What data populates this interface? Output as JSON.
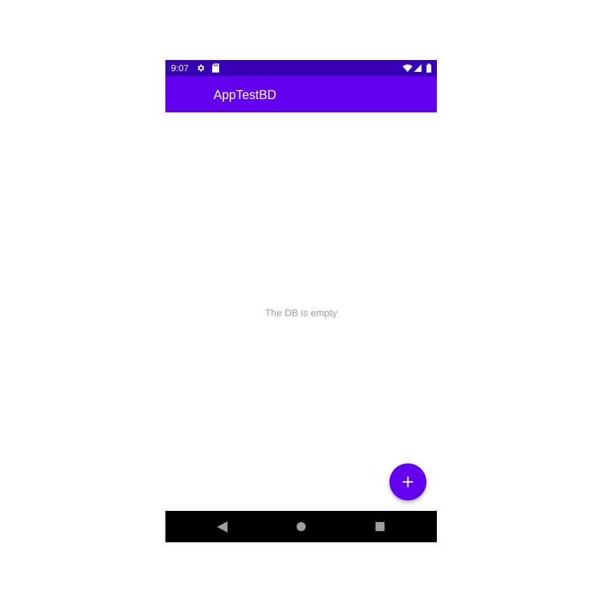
{
  "status_bar": {
    "time": "9:07",
    "left_icons": [
      "gear-icon",
      "sd-card-icon"
    ],
    "right_icons": [
      "wifi-icon",
      "cell-signal-icon",
      "battery-icon"
    ]
  },
  "app_bar": {
    "title": "AppTestBD"
  },
  "content": {
    "empty_message": "The DB is empty"
  },
  "fab": {
    "icon": "plus-icon"
  },
  "nav_bar": {
    "buttons": [
      "back-icon",
      "home-icon",
      "recents-icon"
    ]
  },
  "colors": {
    "status_bar": "#3700b3",
    "primary": "#6200ee",
    "empty_text": "#9e9e9e",
    "nav_bar": "#000000"
  }
}
